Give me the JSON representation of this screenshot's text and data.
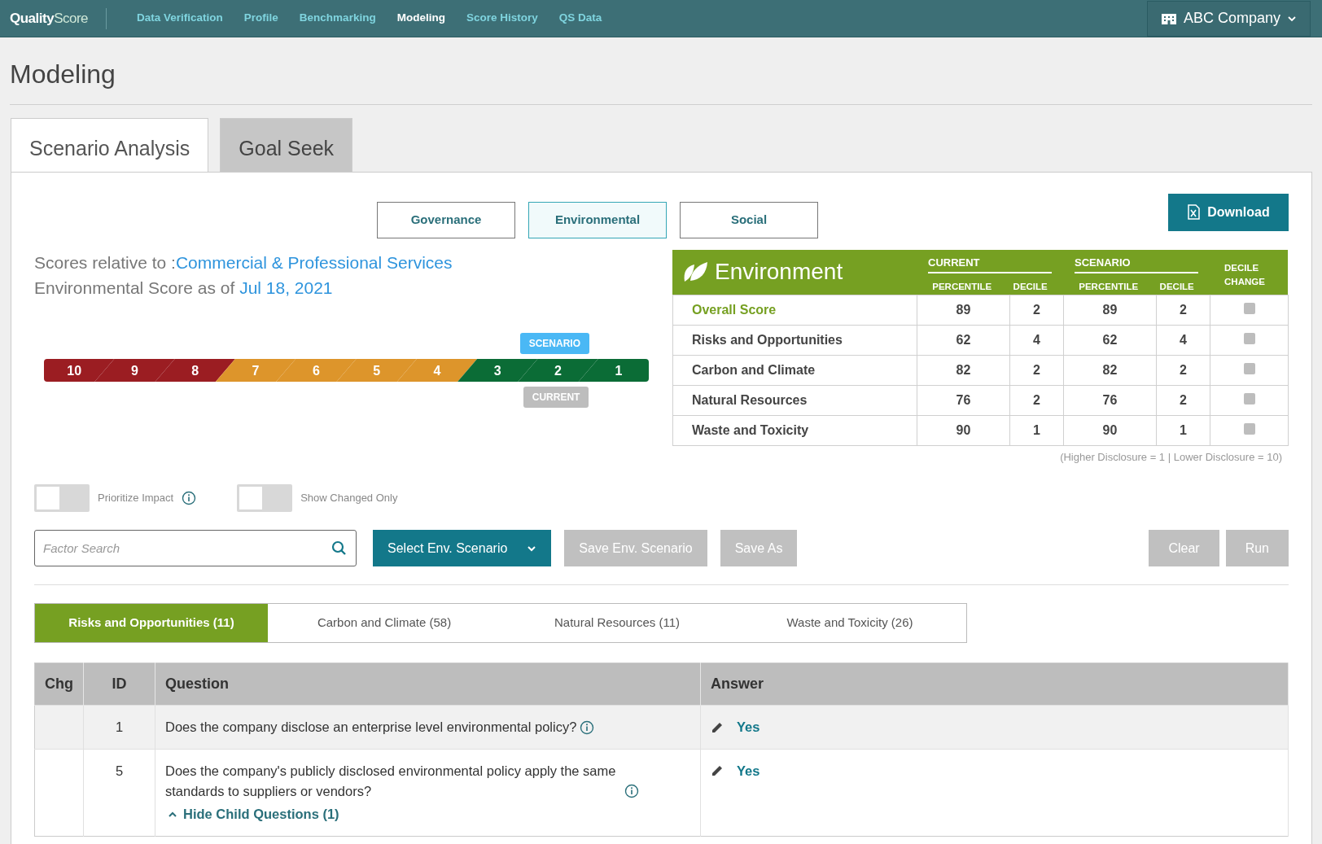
{
  "navbar": {
    "brand_main": "Quality",
    "brand_accent": "Score",
    "links": [
      {
        "label": "Data Verification",
        "selected": false
      },
      {
        "label": "Profile",
        "selected": false
      },
      {
        "label": "Benchmarking",
        "selected": false
      },
      {
        "label": "Modeling",
        "selected": true
      },
      {
        "label": "Score History",
        "selected": false
      },
      {
        "label": "QS Data",
        "selected": false
      }
    ],
    "company": "ABC Company"
  },
  "page_title": "Modeling",
  "tabs": [
    {
      "label": "Scenario Analysis",
      "selected": true
    },
    {
      "label": "Goal Seek",
      "selected": false
    }
  ],
  "pillars": [
    {
      "label": "Governance",
      "selected": false
    },
    {
      "label": "Environmental",
      "selected": true
    },
    {
      "label": "Social",
      "selected": false
    }
  ],
  "download_label": "Download",
  "relative": {
    "prefix": "Scores relative to :",
    "industry": "Commercial & Professional Services",
    "asof_prefix": "Environmental Score as of ",
    "date": "Jul 18, 2021"
  },
  "gauge": {
    "scenario_label": "SCENARIO",
    "current_label": "CURRENT",
    "segments": [
      {
        "label": "10",
        "color": "#9b1d22",
        "scenario": false,
        "current": false
      },
      {
        "label": "9",
        "color": "#9b1d22",
        "scenario": false,
        "current": false
      },
      {
        "label": "8",
        "color": "#9b1d22",
        "scenario": false,
        "current": false
      },
      {
        "label": "7",
        "color": "#dd952b",
        "scenario": false,
        "current": false
      },
      {
        "label": "6",
        "color": "#dd952b",
        "scenario": false,
        "current": false
      },
      {
        "label": "5",
        "color": "#dd952b",
        "scenario": false,
        "current": false
      },
      {
        "label": "4",
        "color": "#dd952b",
        "scenario": false,
        "current": false
      },
      {
        "label": "3",
        "color": "#0b6c36",
        "scenario": false,
        "current": false
      },
      {
        "label": "2",
        "color": "#0b6c36",
        "scenario": true,
        "current": true
      },
      {
        "label": "1",
        "color": "#0b6c36",
        "scenario": false,
        "current": false
      }
    ]
  },
  "score_table": {
    "title": "Environment",
    "groups": [
      {
        "label": "CURRENT",
        "percentile_label": "PERCENTILE",
        "decile_label": "DECILE"
      },
      {
        "label": "SCENARIO",
        "percentile_label": "PERCENTILE",
        "decile_label": "DECILE"
      }
    ],
    "change_label": "DECILE CHANGE",
    "rows": [
      {
        "name": "Overall Score",
        "kind": "overall",
        "cur_pct": "89",
        "cur_dec": "2",
        "scn_pct": "89",
        "scn_dec": "2",
        "checked": false
      },
      {
        "name": "Risks and Opportunities",
        "kind": "factor",
        "cur_pct": "62",
        "cur_dec": "4",
        "scn_pct": "62",
        "scn_dec": "4",
        "checked": false
      },
      {
        "name": "Carbon and Climate",
        "kind": "factor",
        "cur_pct": "82",
        "cur_dec": "2",
        "scn_pct": "82",
        "scn_dec": "2",
        "checked": false
      },
      {
        "name": "Natural Resources",
        "kind": "factor",
        "cur_pct": "76",
        "cur_dec": "2",
        "scn_pct": "76",
        "scn_dec": "2",
        "checked": false
      },
      {
        "name": "Waste and Toxicity",
        "kind": "factor",
        "cur_pct": "90",
        "cur_dec": "1",
        "scn_pct": "90",
        "scn_dec": "1",
        "checked": false
      }
    ],
    "note": "(Higher Disclosure = 1 | Lower Disclosure = 10)"
  },
  "toggles": [
    {
      "label": "Prioritize Impact",
      "on": false,
      "info": true
    },
    {
      "label": "Show Changed Only",
      "on": false,
      "info": false
    }
  ],
  "search": {
    "placeholder": "Factor Search"
  },
  "actions": [
    {
      "label": "Select Env. Scenario",
      "kind": "dropdown",
      "disabled": false
    },
    {
      "label": "Save Env. Scenario",
      "kind": "button",
      "disabled": true
    },
    {
      "label": "Save As",
      "kind": "button",
      "disabled": true
    }
  ],
  "right_actions": [
    {
      "label": "Clear",
      "disabled": true
    },
    {
      "label": "Run",
      "disabled": true
    }
  ],
  "factor_tabs": [
    {
      "label": "Risks and Opportunities (11)",
      "selected": true
    },
    {
      "label": "Carbon and Climate (58)",
      "selected": false
    },
    {
      "label": "Natural Resources (11)",
      "selected": false
    },
    {
      "label": "Waste and Toxicity (26)",
      "selected": false
    }
  ],
  "questions": {
    "columns": [
      "Chg",
      "ID",
      "Question",
      "Answer"
    ],
    "rows": [
      {
        "id": "1",
        "question": "Does the company disclose an enterprise level environmental policy?",
        "answer": "Yes"
      },
      {
        "id": "5",
        "question": "Does the company's publicly disclosed environmental policy apply the same standards to suppliers or vendors?",
        "answer": "Yes",
        "child_toggle": "Hide Child Questions (1)",
        "expanded": true
      }
    ]
  }
}
